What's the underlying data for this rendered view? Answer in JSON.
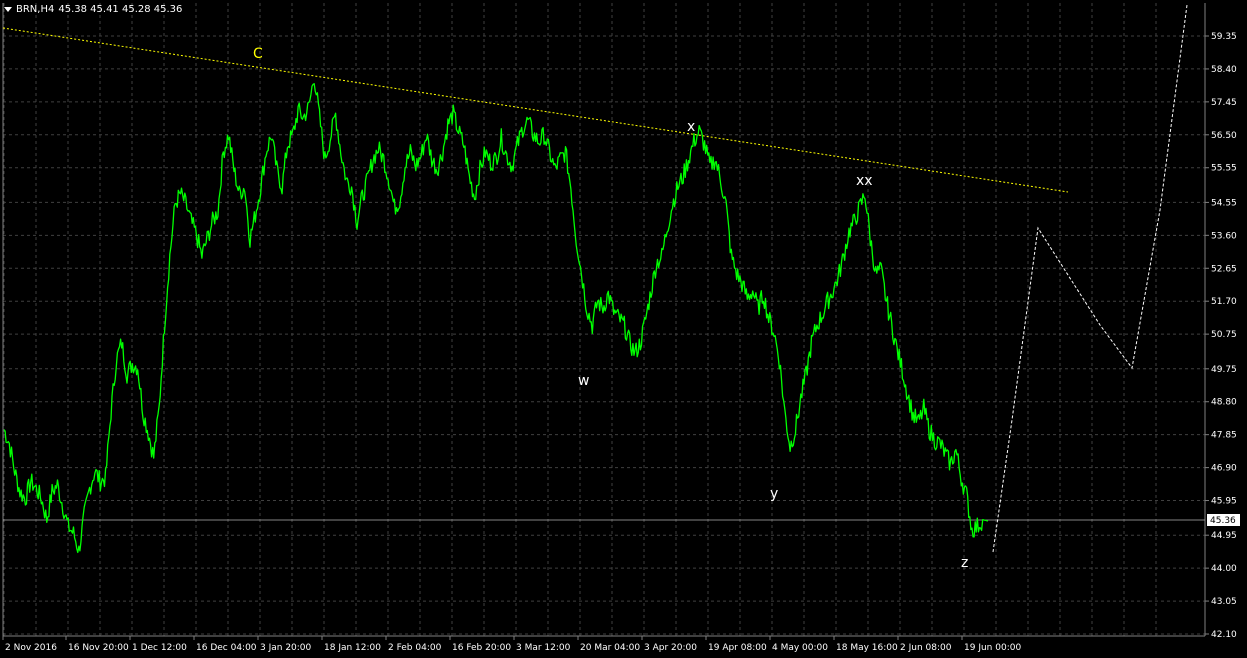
{
  "header": {
    "symbol": "BRN,H4",
    "ohlc": "45.38 45.41 45.28 45.36"
  },
  "colors": {
    "background": "#000000",
    "grid": "#404040",
    "price_line": "#00ff00",
    "trendline": "#ffff00",
    "projection": "#ffffff",
    "text": "#ffffff",
    "label_c": "#ffff00"
  },
  "chart_data": {
    "type": "line",
    "grid": true,
    "y_ticks": [
      "59.35",
      "58.40",
      "57.45",
      "56.50",
      "55.55",
      "54.55",
      "53.60",
      "52.65",
      "51.70",
      "50.75",
      "49.75",
      "48.80",
      "47.85",
      "46.90",
      "45.95",
      "44.95",
      "44.00",
      "43.05",
      "42.10"
    ],
    "x_ticks": [
      "2 Nov 2016",
      "16 Nov 20:00",
      "1 Dec 12:00",
      "16 Dec 04:00",
      "3 Jan 20:00",
      "18 Jan 12:00",
      "2 Feb 04:00",
      "16 Feb 20:00",
      "3 Mar 12:00",
      "20 Mar 04:00",
      "3 Apr 20:00",
      "19 Apr 08:00",
      "4 May 00:00",
      "18 May 16:00",
      "2 Jun 08:00",
      "19 Jun 00:00"
    ],
    "ylim": [
      42.1,
      59.35
    ],
    "current_price": "45.36",
    "price_series": [
      48.0,
      47.6,
      46.8,
      46.2,
      46.0,
      46.5,
      46.3,
      46.0,
      45.4,
      46.2,
      46.4,
      45.8,
      45.2,
      45.0,
      44.5,
      45.5,
      46.3,
      46.8,
      46.5,
      46.6,
      48.5,
      50.0,
      50.5,
      49.6,
      49.9,
      49.8,
      48.5,
      47.9,
      47.2,
      48.6,
      51.0,
      53.0,
      54.5,
      54.8,
      54.5,
      54.0,
      53.6,
      53.0,
      53.5,
      54.0,
      54.3,
      56.0,
      56.5,
      55.5,
      54.8,
      55.0,
      53.5,
      54.2,
      55.0,
      56.0,
      56.5,
      55.5,
      55.0,
      56.2,
      56.5,
      57.2,
      57.0,
      57.3,
      58.2,
      57.0,
      55.8,
      56.4,
      57.1,
      56.0,
      55.2,
      55.0,
      54.0,
      54.7,
      55.2,
      55.8,
      56.1,
      55.8,
      55.2,
      54.4,
      54.6,
      55.6,
      56.0,
      55.6,
      55.9,
      56.5,
      55.8,
      55.5,
      56.0,
      56.8,
      57.1,
      56.6,
      56.2,
      55.3,
      54.7,
      55.5,
      56.0,
      55.7,
      55.8,
      56.4,
      55.9,
      55.6,
      56.2,
      56.7,
      56.9,
      56.5,
      56.3,
      56.5,
      56.0,
      55.5,
      55.8,
      56.0,
      55.0,
      53.5,
      52.5,
      51.5,
      51.0,
      51.7,
      51.5,
      51.9,
      51.4,
      51.2,
      51.0,
      50.5,
      50.2,
      50.5,
      51.2,
      52.0,
      52.8,
      53.0,
      53.8,
      54.5,
      55.0,
      55.3,
      55.8,
      56.3,
      56.6,
      56.2,
      55.6,
      55.8,
      55.2,
      54.5,
      53.0,
      52.5,
      52.2,
      51.8,
      52.0,
      51.5,
      51.9,
      51.2,
      50.8,
      50.0,
      48.5,
      47.5,
      48.0,
      48.9,
      49.6,
      50.5,
      51.0,
      51.3,
      51.7,
      52.0,
      52.4,
      53.0,
      53.7,
      54.0,
      54.4,
      54.8,
      53.5,
      52.5,
      52.6,
      51.7,
      51.0,
      50.3,
      49.7,
      49.0,
      48.4,
      48.2,
      48.6,
      48.0,
      47.7,
      47.6,
      47.3,
      47.0,
      47.4,
      46.6,
      46.1,
      45.1,
      45.2,
      45.4,
      45.36
    ],
    "annotations": [
      "C",
      "x",
      "w",
      "xx",
      "y",
      "z"
    ]
  }
}
